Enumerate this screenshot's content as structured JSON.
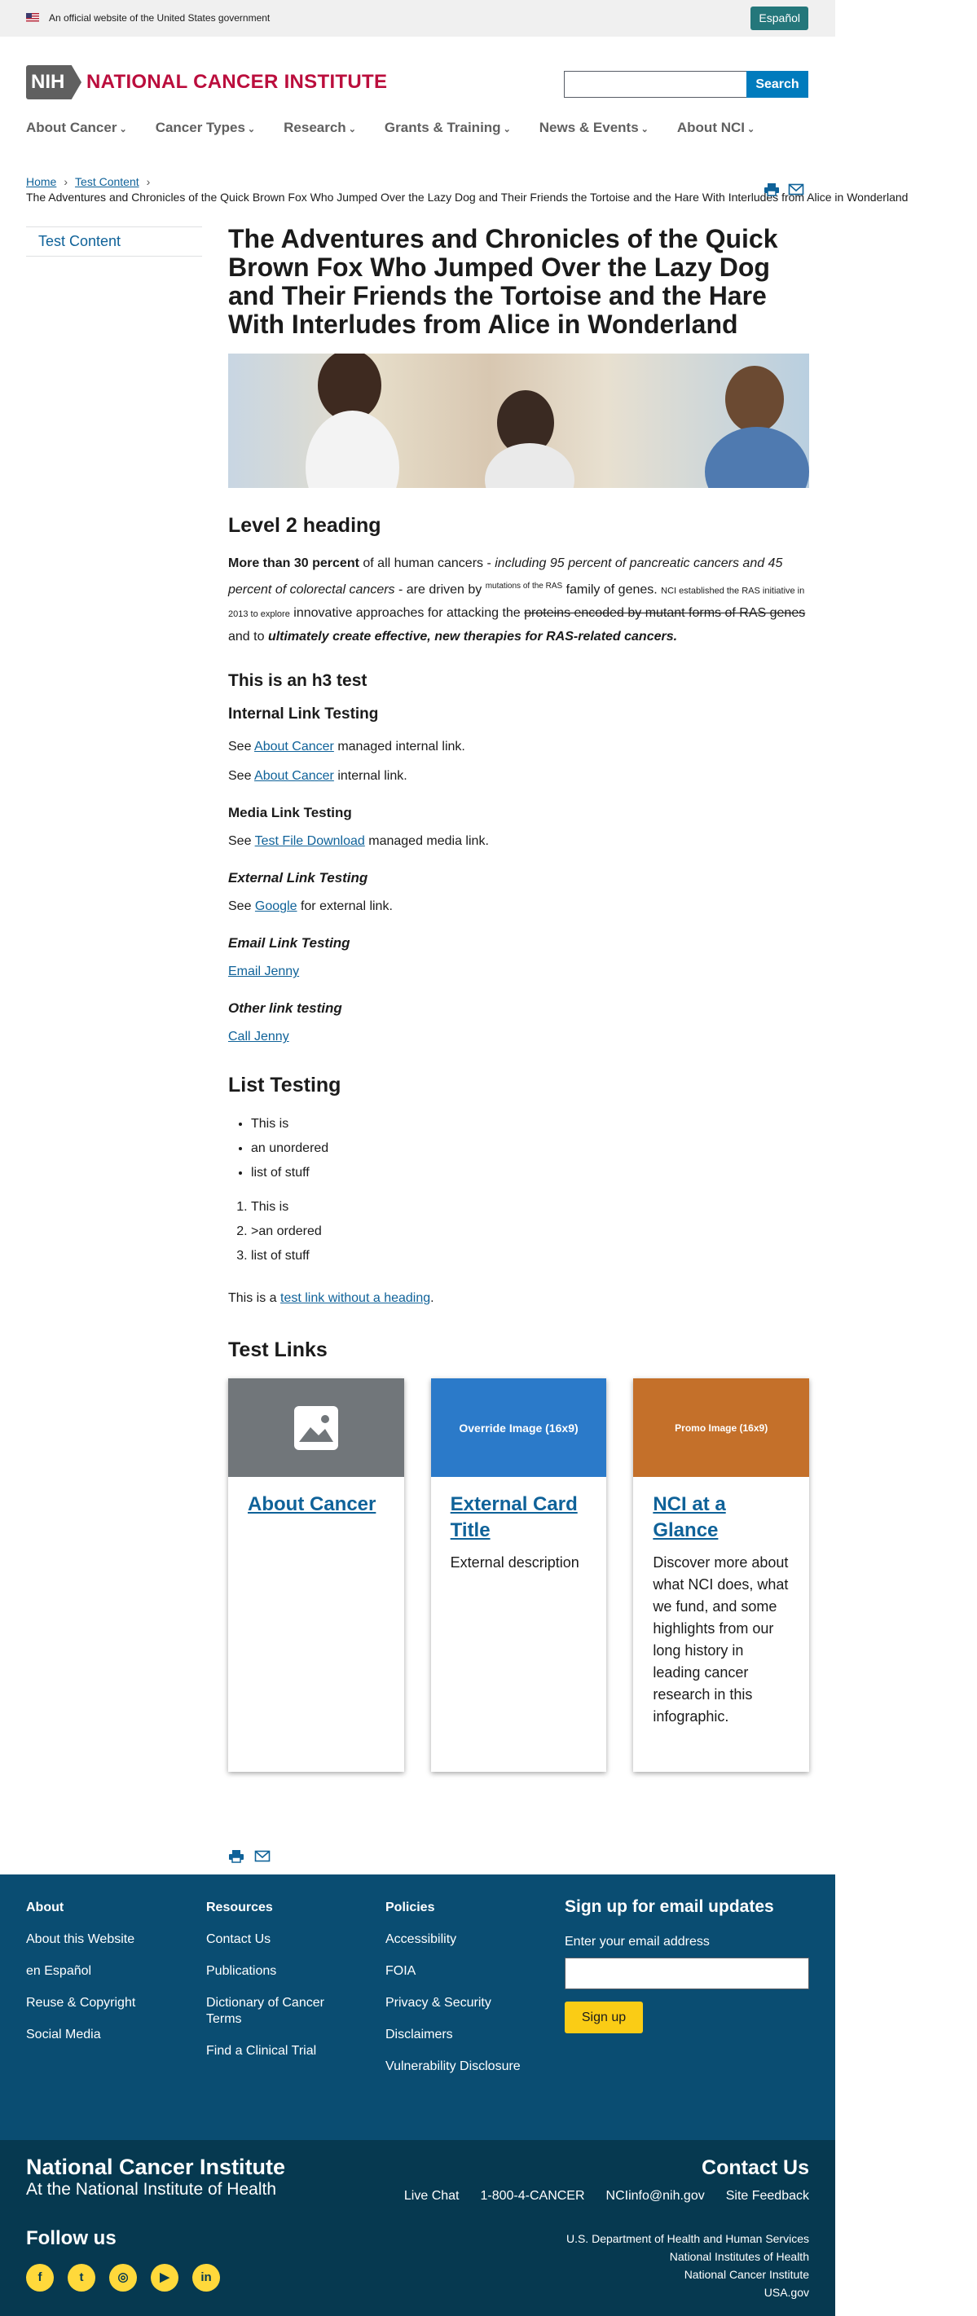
{
  "banner": {
    "text": "An official website of the United States government",
    "espanol": "Español"
  },
  "header": {
    "nih": "NIH",
    "title": "NATIONAL CANCER INSTITUTE",
    "search_button": "Search"
  },
  "nav": [
    {
      "label": "About Cancer"
    },
    {
      "label": "Cancer Types"
    },
    {
      "label": "Research"
    },
    {
      "label": "Grants & Training"
    },
    {
      "label": "News & Events"
    },
    {
      "label": "About NCI"
    }
  ],
  "breadcrumb": {
    "home": "Home",
    "section": "Test Content",
    "current": "The Adventures and Chronicles of the Quick Brown Fox Who Jumped Over the Lazy Dog and Their Friends the Tortoise and the Hare With Interludes from Alice in Wonderland"
  },
  "sidebar": {
    "item": "Test Content"
  },
  "article": {
    "title": "The Adventures and Chronicles of the Quick Brown Fox Who Jumped Over the Lazy Dog and Their Friends the Tortoise and the Hare With Interludes from Alice in Wonderland",
    "h2": "Level 2 heading",
    "p_bold": "More than 30 percent",
    "p_1": " of all human cancers - ",
    "p_italic": "including 95 percent of pancreatic cancers and 45 percent of colorectal cancers",
    "p_2": " - are driven by ",
    "p_sup": "mutations of the RAS",
    "p_3": " family of genes. ",
    "p_small": "NCI established the RAS initiative in 2013 to explore",
    "p_4": " innovative approaches for attacking the ",
    "p_strike": "proteins encoded by mutant forms of RAS genes",
    "p_5": " and to ",
    "p_bolditalic": "ultimately create effective, new therapies for RAS-related cancers.",
    "h3": "This is an h3 test",
    "h4": "Internal Link Testing",
    "see": "See ",
    "int1_link": "About Cancer",
    "int1_rest": " managed internal link.",
    "int2_link": "About Cancer",
    "int2_rest": " internal link.",
    "h5": "Media Link Testing",
    "media_link": "Test File Download",
    "media_rest": " managed media link.",
    "h6_ext": "External Link Testing",
    "ext_link": "Google",
    "ext_rest": " for external link.",
    "h6_email": "Email Link Testing",
    "email_link": "Email Jenny",
    "h6_other": "Other link testing",
    "call_link": "Call Jenny",
    "list_heading": "List Testing",
    "ul": [
      "This is",
      "an unordered",
      "list of stuff"
    ],
    "ol": [
      "This is",
      ">an ordered",
      "list of stuff"
    ],
    "nohead_pre": "This is a ",
    "nohead_link": "test link without a heading",
    "nohead_post": ".",
    "test_links": "Test Links"
  },
  "cards": [
    {
      "image_text": "",
      "title": "About Cancer",
      "desc": "",
      "color": "#71767a"
    },
    {
      "image_text": "Override Image (16x9)",
      "title": "External Card Title",
      "desc": "External description",
      "color": "#2b7ac9"
    },
    {
      "image_text": "Promo Image (16x9)",
      "title": "NCI at a Glance",
      "desc": "Discover more about what NCI does, what we fund, and some highlights from our long history in leading cancer research in this infographic.",
      "color": "#c4702a"
    }
  ],
  "footer": {
    "about": {
      "heading": "About",
      "items": [
        "About this Website",
        "en Español",
        "Reuse & Copyright",
        "Social Media"
      ]
    },
    "resources": {
      "heading": "Resources",
      "items": [
        "Contact Us",
        "Publications",
        "Dictionary of Cancer Terms",
        "Find a Clinical Trial"
      ]
    },
    "policies": {
      "heading": "Policies",
      "items": [
        "Accessibility",
        "FOIA",
        "Privacy & Security",
        "Disclaimers",
        "Vulnerability Disclosure"
      ]
    },
    "signup": {
      "title": "Sign up for email updates",
      "label": "Enter your email address",
      "button": "Sign up"
    },
    "org": "National Cancer Institute",
    "org_sub": "At the National Institute of Health",
    "follow": "Follow us",
    "contact_title": "Contact Us",
    "contact_links": [
      "Live Chat",
      "1-800-4-CANCER",
      "NCIinfo@nih.gov",
      "Site Feedback"
    ],
    "gov": [
      "U.S. Department of Health and Human Services",
      "National Institutes of Health",
      "National Cancer Institute",
      "USA.gov"
    ]
  }
}
